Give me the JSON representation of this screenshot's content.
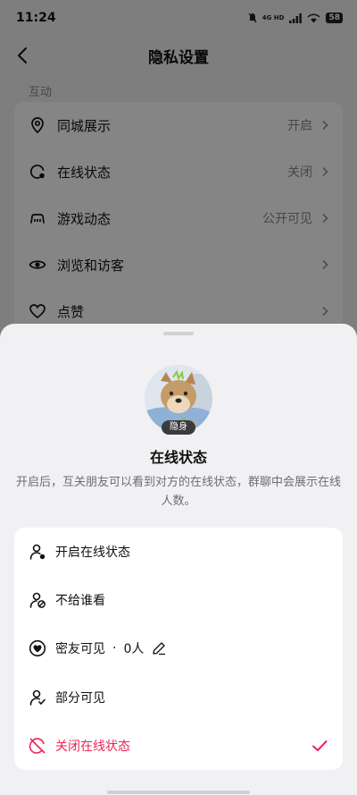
{
  "status_bar": {
    "time": "11:24",
    "network_line1": "4G HD",
    "battery": "58"
  },
  "nav": {
    "title": "隐私设置"
  },
  "section_label": "互动",
  "settings": [
    {
      "label": "同城展示",
      "value": "开启"
    },
    {
      "label": "在线状态",
      "value": "关闭"
    },
    {
      "label": "游戏动态",
      "value": "公开可见"
    },
    {
      "label": "浏览和访客",
      "value": ""
    },
    {
      "label": "点赞",
      "value": ""
    }
  ],
  "sheet": {
    "badge": "隐身",
    "title": "在线状态",
    "description": "开启后，互关朋友可以看到对方的在线状态，群聊中会展示在线人数。",
    "options": [
      {
        "label": "开启在线状态",
        "icon": "user-online-icon"
      },
      {
        "label": "不给谁看",
        "icon": "user-block-icon"
      },
      {
        "label": "密友可见",
        "separator": "·",
        "count": "0人",
        "icon": "heart-friend-icon"
      },
      {
        "label": "部分可见",
        "icon": "user-check-icon"
      },
      {
        "label": "关闭在线状态",
        "icon": "offline-icon",
        "selected": true
      }
    ]
  },
  "colors": {
    "accent": "#ee2456",
    "overlay": "rgba(0,0,0,0.48)"
  }
}
